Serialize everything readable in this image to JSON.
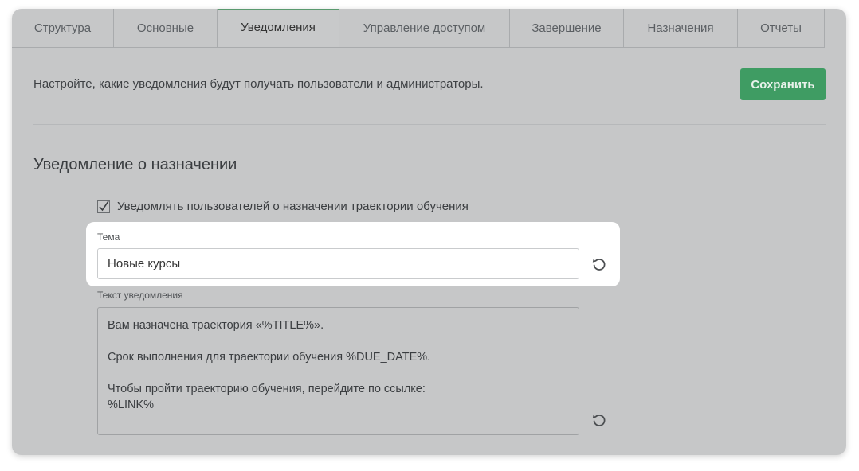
{
  "tabs": [
    {
      "label": "Структура",
      "active": false
    },
    {
      "label": "Основные",
      "active": false
    },
    {
      "label": "Уведомления",
      "active": true
    },
    {
      "label": "Управление доступом",
      "active": false
    },
    {
      "label": "Завершение",
      "active": false
    },
    {
      "label": "Назначения",
      "active": false
    },
    {
      "label": "Отчеты",
      "active": false
    }
  ],
  "description": "Настройте, какие уведомления будут получать пользователи и администраторы.",
  "save_label": "Сохранить",
  "section_title": "Уведомление о назначении",
  "notify_checkbox": {
    "label": "Уведомлять пользователей о назначении траектории обучения",
    "checked": true
  },
  "subject": {
    "label": "Тема",
    "value": "Новые курсы"
  },
  "body": {
    "label": "Текст уведомления",
    "lines": [
      "Вам назначена траектория «%TITLE%».",
      "",
      "Срок выполнения для траектории обучения %DUE_DATE%.",
      "",
      "Чтобы пройти траекторию обучения, перейдите по ссылке:",
      "%LINK%"
    ]
  },
  "colors": {
    "accent": "#3f9c63",
    "overlay": "#c6c7c8"
  },
  "icons": {
    "reset": "reset-icon",
    "check": "checkmark-icon"
  }
}
